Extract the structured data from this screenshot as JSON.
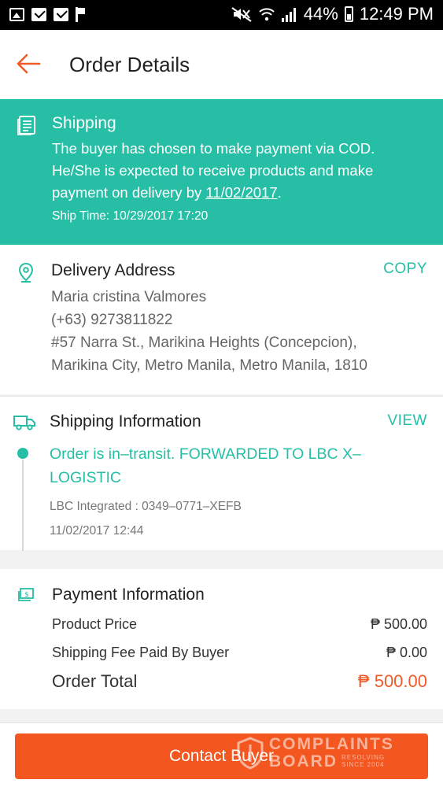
{
  "status_bar": {
    "battery": "44%",
    "time": "12:49 PM"
  },
  "app_bar": {
    "title": "Order Details"
  },
  "shipping_banner": {
    "title": "Shipping",
    "body_prefix": "The buyer has chosen to make payment via COD. He/She is expected to receive products and make payment on delivery by ",
    "body_date": "11/02/2017",
    "body_suffix": ".",
    "ship_time": "Ship Time: 10/29/2017 17:20"
  },
  "delivery_address": {
    "title": "Delivery Address",
    "copy_label": "COPY",
    "name": "Maria cristina Valmores",
    "phone": "(+63) 9273811822",
    "line1": "#57 Narra St., Marikina Heights (Concepcion),",
    "line2": "Marikina City, Metro Manila, Metro Manila, 1810"
  },
  "shipping_info": {
    "title": "Shipping Information",
    "view_label": "VIEW",
    "status": "Order is in–transit. FORWARDED TO LBC X–LOGISTIC",
    "reference": "LBC Integrated :  0349–0771–XEFB",
    "timestamp": "11/02/2017 12:44"
  },
  "payment_info": {
    "title": "Payment Information",
    "rows": [
      {
        "label": "Product Price",
        "amount": "₱ 500.00"
      },
      {
        "label": "Shipping Fee Paid By Buyer",
        "amount": "₱ 0.00"
      }
    ],
    "total_label": "Order Total",
    "total_amount": "₱ 500.00"
  },
  "bottom": {
    "contact_label": "Contact Buyer"
  },
  "watermark": {
    "line1": "COMPLAINTS",
    "line2": "BOARD",
    "line3a": "RESOLVING",
    "line3b": "SINCE 2004"
  },
  "colors": {
    "accent": "#26bfa6",
    "primary_button": "#f3561f",
    "total_amount": "#f05a28"
  }
}
